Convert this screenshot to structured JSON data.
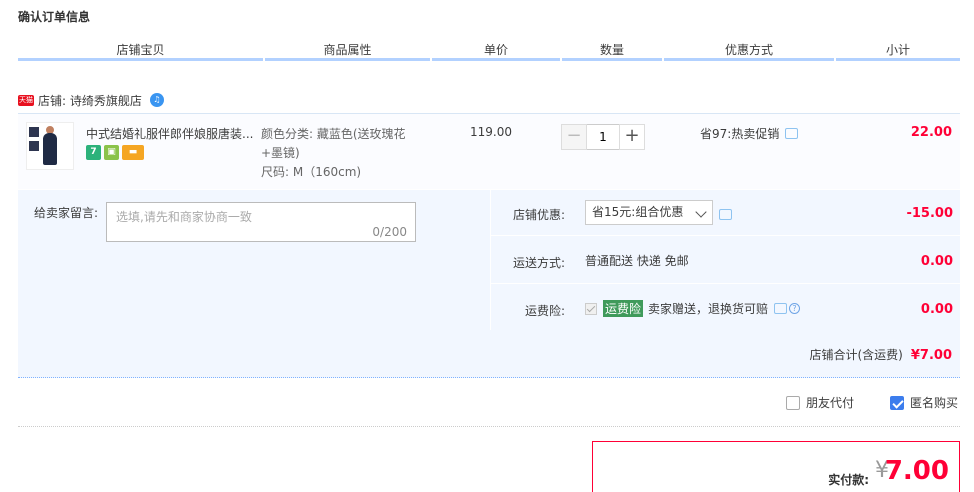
{
  "page": {
    "title": "确认订单信息"
  },
  "columns": {
    "item": "店铺宝贝",
    "attributes": "商品属性",
    "price": "单价",
    "quantity": "数量",
    "discount": "优惠方式",
    "subtotal": "小计"
  },
  "shop": {
    "badge": "天猫",
    "name": "店铺: 诗绮秀旗舰店"
  },
  "item": {
    "title": "中式结婚礼服伴郎伴娘服唐装...",
    "icons": [
      "7",
      "guarantee-icon",
      "card-icon"
    ],
    "attr_color": "颜色分类: 藏蓝色(送玫瑰花+墨镜)",
    "attr_size": "尺码: M（160cm)",
    "price": "119.00",
    "quantity": "1",
    "promotion": "省97:热卖促销",
    "subtotal": "22.00"
  },
  "message": {
    "label": "给卖家留言:",
    "placeholder": "选填,请先和商家协商一致",
    "counter": "0/200"
  },
  "shop_discount": {
    "label": "店铺优惠:",
    "selected": "省15元:组合优惠",
    "amount": "-15.00"
  },
  "shipping": {
    "label": "运送方式:",
    "value": "普通配送 快递 免邮",
    "amount": "0.00"
  },
  "insurance": {
    "label": "运费险:",
    "tag": "运费险",
    "desc": "卖家赠送，退换货可赔",
    "amount": "0.00"
  },
  "shop_total": {
    "label": "店铺合计(含运费)",
    "amount": "¥7.00"
  },
  "checkout_options": {
    "friend_pay": "朋友代付",
    "friend_pay_checked": false,
    "anonymous": "匿名购买",
    "anonymous_checked": true
  },
  "payment": {
    "label": "实付款:",
    "currency": "¥",
    "amount": "7.00"
  },
  "colors": {
    "accent_red": "#ff0036",
    "header_line": "#b2d1ff",
    "panel_bg": "#f2f7ff",
    "check_blue": "#3c7ded"
  }
}
